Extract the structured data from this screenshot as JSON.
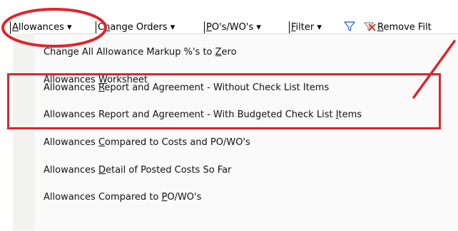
{
  "toolbar": {
    "allowances": {
      "pre": "",
      "u": "A",
      "post": "llowances ▾"
    },
    "change_orders": {
      "pre": "C",
      "u": "h",
      "post": "ange Orders ▾"
    },
    "po_wo": {
      "pre": "",
      "u": "P",
      "post": "O's/WO's ▾"
    },
    "filter": {
      "pre": "",
      "u": "F",
      "post": "ilter ▾"
    },
    "remove_filter": {
      "pre": "",
      "u": "R",
      "post": "emove Filt"
    }
  },
  "menu": {
    "items": [
      {
        "pre": "Change All Allowance Markup %'s to ",
        "u": "Z",
        "post": "ero"
      },
      {
        "pre": "Allowances ",
        "u": "W",
        "post": "orksheet"
      },
      {
        "pre": "Allowances ",
        "u": "R",
        "post": "eport and Agreement - Without Check List Items"
      },
      {
        "pre": "Allowances Report and Agreement - With Budgeted Check List ",
        "u": "I",
        "post": "tems"
      },
      {
        "pre": "Allowances ",
        "u": "C",
        "post": "ompared to Costs and PO/WO's"
      },
      {
        "pre": "Allowances ",
        "u": "D",
        "post": "etail of Posted Costs So Far"
      },
      {
        "pre": "Allowances Compared to ",
        "u": "P",
        "post": "O/WO's"
      }
    ]
  },
  "colors": {
    "annotation": "#e0242a",
    "filter_icon": "#3a6fd0"
  }
}
